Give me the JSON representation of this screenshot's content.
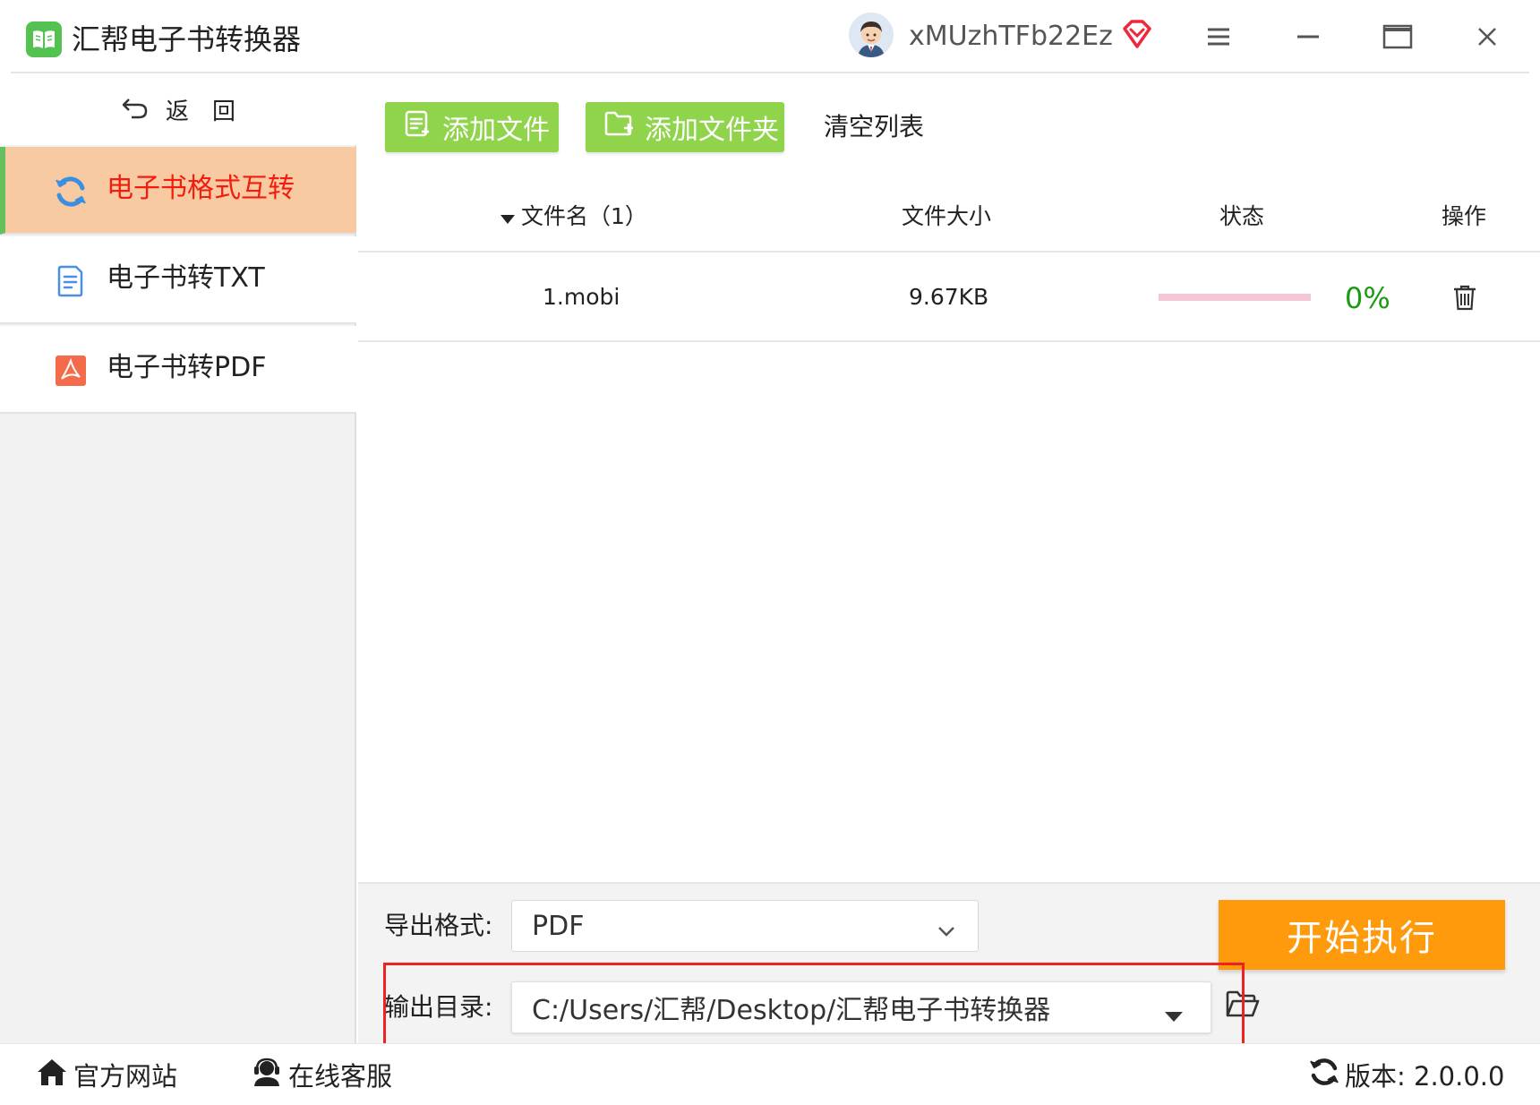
{
  "app": {
    "title": "汇帮电子书转换器",
    "username": "xMUzhTFb22Ez"
  },
  "window_controls": [
    "menu-icon",
    "minimize-icon",
    "maximize-icon",
    "close-icon"
  ],
  "sidebar": {
    "back_label": "返　回",
    "items": [
      {
        "label": "电子书格式互转",
        "icon": "refresh-icon",
        "active": true
      },
      {
        "label": "电子书转TXT",
        "icon": "document-icon",
        "active": false
      },
      {
        "label": "电子书转PDF",
        "icon": "pdf-icon",
        "active": false
      }
    ]
  },
  "toolbar": {
    "add_file": "添加文件",
    "add_folder": "添加文件夹",
    "clear_list": "清空列表"
  },
  "table": {
    "columns": {
      "filename": "文件名（1）",
      "size": "文件大小",
      "status": "状态",
      "action": "操作"
    },
    "rows": [
      {
        "filename": "1.mobi",
        "size": "9.67KB",
        "progress": 0,
        "progress_text": "0%"
      }
    ]
  },
  "export": {
    "format_label": "导出格式:",
    "format_value": "PDF",
    "output_label": "输出目录:",
    "output_value": "C:/Users/汇帮/Desktop/汇帮电子书转换器",
    "start_button": "开始执行"
  },
  "footer": {
    "website": "官方网站",
    "support": "在线客服",
    "version": "版本:  2.0.0.0"
  },
  "colors": {
    "accent_green": "#8fd44b",
    "active_bg": "#f8caa1",
    "active_text": "#f21d0e",
    "start_orange": "#ff9a0c",
    "progress_text": "#1c9a14",
    "highlight_red": "#ee2222"
  }
}
